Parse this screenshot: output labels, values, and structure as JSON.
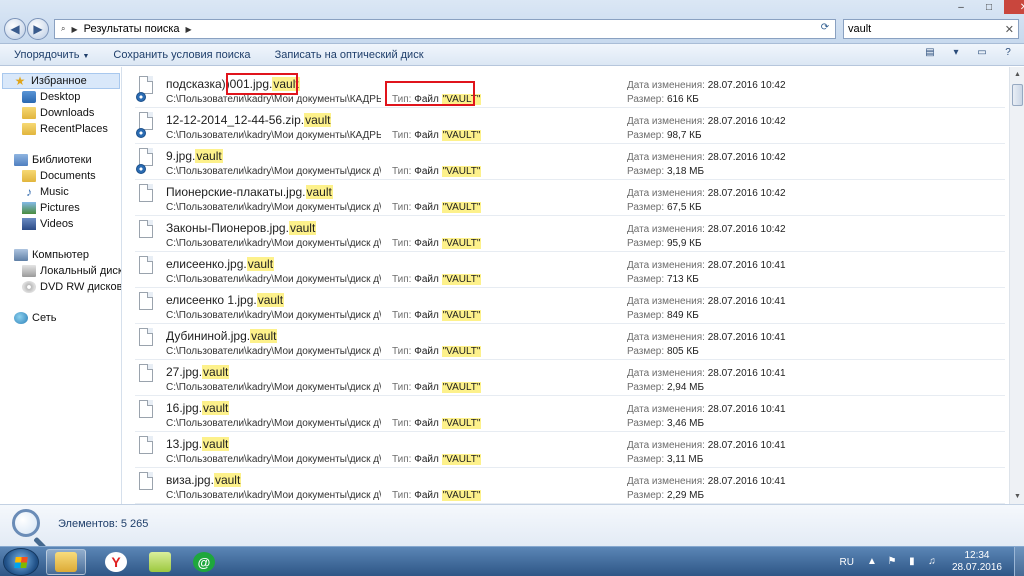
{
  "window": {
    "buttons": {
      "minimize": "–",
      "maximize": "□",
      "close": "✕"
    }
  },
  "address": {
    "crumb": "Результаты поиска",
    "search_value": "vault"
  },
  "commands": {
    "organize": "Упорядочить",
    "save_search": "Сохранить условия поиска",
    "burn": "Записать на оптический диск"
  },
  "nav": {
    "favorites": "Избранное",
    "desktop": "Desktop",
    "downloads": "Downloads",
    "recent": "RecentPlaces",
    "libraries": "Библиотеки",
    "documents": "Documents",
    "music": "Music",
    "pictures": "Pictures",
    "videos": "Videos",
    "computer": "Компьютер",
    "local_disk": "Локальный диск (C:",
    "dvd": "DVD RW дисковод (D",
    "network": "Сеть"
  },
  "labels": {
    "type": "Тип:",
    "date": "Дата изменения:",
    "size": "Размер:"
  },
  "files": [
    {
      "name_pre": "подсказка))",
      "name_base": "001.jpg.",
      "name_hl": "vault",
      "path": "C:\\Пользователи\\kadry\\Мои документы\\КАДРЫ\\с...",
      "type_pre": "Файл ",
      "type_hl": "\"VAULT\"",
      "date": "28.07.2016 10:42",
      "size": "616 КБ",
      "overlay": true
    },
    {
      "name_pre": "",
      "name_base": "12-12-2014_12-44-56.zip.",
      "name_hl": "vault",
      "path": "C:\\Пользователи\\kadry\\Мои документы\\КАДРЫ\\...",
      "type_pre": "Файл ",
      "type_hl": "\"VAULT\"",
      "date": "28.07.2016 10:42",
      "size": "98,7 КБ",
      "overlay": true
    },
    {
      "name_pre": "",
      "name_base": "9.jpg.",
      "name_hl": "vault",
      "path": "C:\\Пользователи\\kadry\\Мои документы\\диск д\\У...",
      "type_pre": "Файл ",
      "type_hl": "\"VAULT\"",
      "date": "28.07.2016 10:42",
      "size": "3,18 МБ",
      "overlay": true
    },
    {
      "name_pre": "",
      "name_base": "Пионерские-плакаты.jpg.",
      "name_hl": "vault",
      "path": "C:\\Пользователи\\kadry\\Мои документы\\диск д\\с...",
      "type_pre": "Файл ",
      "type_hl": "\"VAULT\"",
      "date": "28.07.2016 10:42",
      "size": "67,5 КБ",
      "overlay": false
    },
    {
      "name_pre": "",
      "name_base": "Законы-Пионеров.jpg.",
      "name_hl": "vault",
      "path": "C:\\Пользователи\\kadry\\Мои документы\\диск д\\с...",
      "type_pre": "Файл ",
      "type_hl": "\"VAULT\"",
      "date": "28.07.2016 10:42",
      "size": "95,9 КБ",
      "overlay": false
    },
    {
      "name_pre": "",
      "name_base": "елисеенко.jpg.",
      "name_hl": "vault",
      "path": "C:\\Пользователи\\kadry\\Мои документы\\диск д\\с...",
      "type_pre": "Файл ",
      "type_hl": "\"VAULT\"",
      "date": "28.07.2016 10:41",
      "size": "713 КБ",
      "overlay": false
    },
    {
      "name_pre": "",
      "name_base": "елисеенко 1.jpg.",
      "name_hl": "vault",
      "path": "C:\\Пользователи\\kadry\\Мои документы\\диск д\\с...",
      "type_pre": "Файл ",
      "type_hl": "\"VAULT\"",
      "date": "28.07.2016 10:41",
      "size": "849 КБ",
      "overlay": false
    },
    {
      "name_pre": "",
      "name_base": "Дубининой.jpg.",
      "name_hl": "vault",
      "path": "C:\\Пользователи\\kadry\\Мои документы\\диск д\\с...",
      "type_pre": "Файл ",
      "type_hl": "\"VAULT\"",
      "date": "28.07.2016 10:41",
      "size": "805 КБ",
      "overlay": false
    },
    {
      "name_pre": "",
      "name_base": "27.jpg.",
      "name_hl": "vault",
      "path": "C:\\Пользователи\\kadry\\Мои документы\\диск д\\с...",
      "type_pre": "Файл ",
      "type_hl": "\"VAULT\"",
      "date": "28.07.2016 10:41",
      "size": "2,94 МБ",
      "overlay": false
    },
    {
      "name_pre": "",
      "name_base": "16.jpg.",
      "name_hl": "vault",
      "path": "C:\\Пользователи\\kadry\\Мои документы\\диск д\\с...",
      "type_pre": "Файл ",
      "type_hl": "\"VAULT\"",
      "date": "28.07.2016 10:41",
      "size": "3,46 МБ",
      "overlay": false
    },
    {
      "name_pre": "",
      "name_base": "13.jpg.",
      "name_hl": "vault",
      "path": "C:\\Пользователи\\kadry\\Мои документы\\диск д\\с...",
      "type_pre": "Файл ",
      "type_hl": "\"VAULT\"",
      "date": "28.07.2016 10:41",
      "size": "3,11 МБ",
      "overlay": false
    },
    {
      "name_pre": "",
      "name_base": "виза.jpg.",
      "name_hl": "vault",
      "path": "C:\\Пользователи\\kadry\\Мои документы\\диск д\\с...",
      "type_pre": "Файл ",
      "type_hl": "\"VAULT\"",
      "date": "28.07.2016 10:41",
      "size": "2,29 МБ",
      "overlay": false
    }
  ],
  "status": {
    "count": "Элементов: 5 265"
  },
  "taskbar": {
    "lang": "RU",
    "time": "12:34",
    "date": "28.07.2016",
    "yandex_letter": "Y",
    "mail_glyph": "@"
  },
  "colors": {
    "highlight": "#fdf18b",
    "annotation": "#e0141c",
    "taskbar": "#2e5686"
  }
}
